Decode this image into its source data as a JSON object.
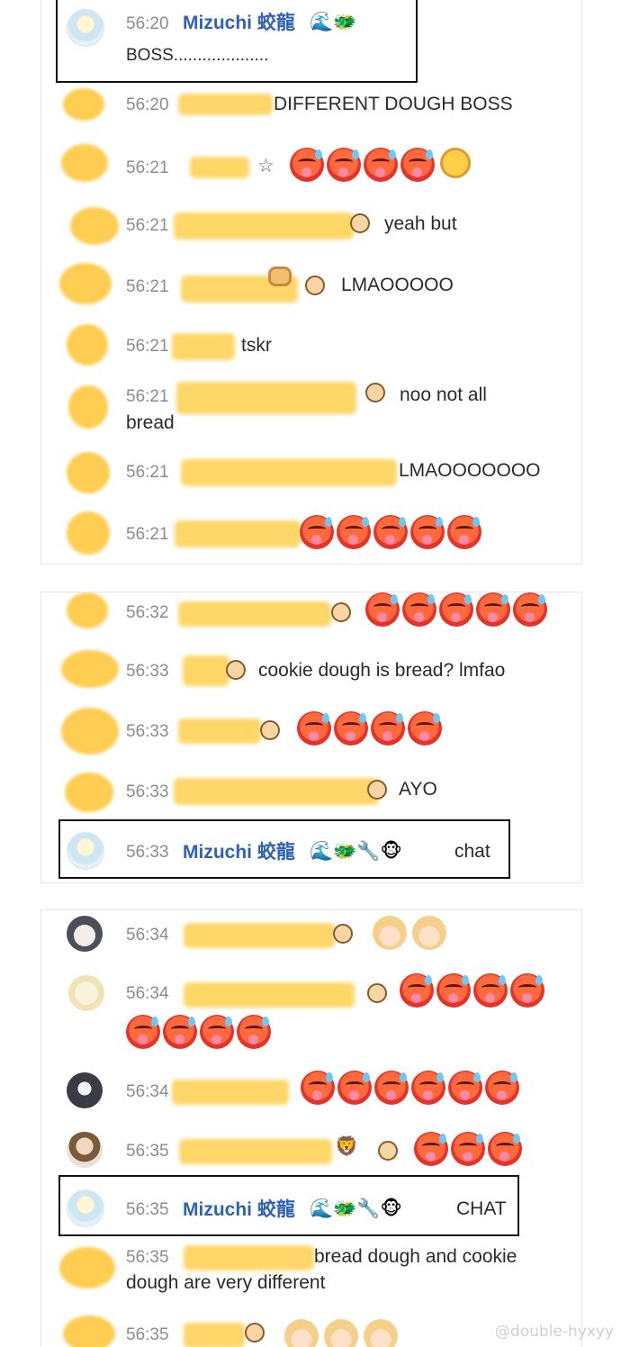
{
  "panel1": {
    "messages": [
      {
        "time": "56:20",
        "name": "Mizuchi 蛟龍",
        "badges": "🌊🐲",
        "text": "BOSS....................",
        "highlighted": true
      },
      {
        "time": "56:20",
        "text": "DIFFERENT DOUGH BOSS"
      },
      {
        "time": "56:21",
        "text": "☆"
      },
      {
        "time": "56:21",
        "text": "yeah but"
      },
      {
        "time": "56:21",
        "text": "LMAOOOOO"
      },
      {
        "time": "56:21",
        "text": "tskr"
      },
      {
        "time": "56:21",
        "text": "noo not all",
        "text2": "bread"
      },
      {
        "time": "56:21",
        "text": "LMAOOOOOOO"
      },
      {
        "time": "56:21",
        "text": ""
      }
    ]
  },
  "panel2": {
    "messages": [
      {
        "time": "56:32"
      },
      {
        "time": "56:33",
        "text": "cookie dough is bread? lmfao"
      },
      {
        "time": "56:33"
      },
      {
        "time": "56:33",
        "text": "AYO"
      },
      {
        "time": "56:33",
        "name": "Mizuchi 蛟龍",
        "badges": "🌊🐲🔧🐵",
        "text": "chat",
        "highlighted": true
      }
    ]
  },
  "panel3": {
    "messages": [
      {
        "time": "56:34"
      },
      {
        "time": "56:34"
      },
      {
        "time": "56:34"
      },
      {
        "time": "56:35",
        "text": "🦁"
      },
      {
        "time": "56:35",
        "name": "Mizuchi 蛟龍",
        "badges": "🌊🐲🔧🐵",
        "text": "CHAT",
        "highlighted": true
      },
      {
        "time": "56:35",
        "text": "bread dough and cookie",
        "text2": "dough are very different"
      },
      {
        "time": "56:35"
      }
    ]
  },
  "watermark": "@double-hyxyy",
  "colors": {
    "name_blue": "#2f62b3",
    "time_gray": "#8c8c8c",
    "blur_yellow": "#ffd35c"
  }
}
